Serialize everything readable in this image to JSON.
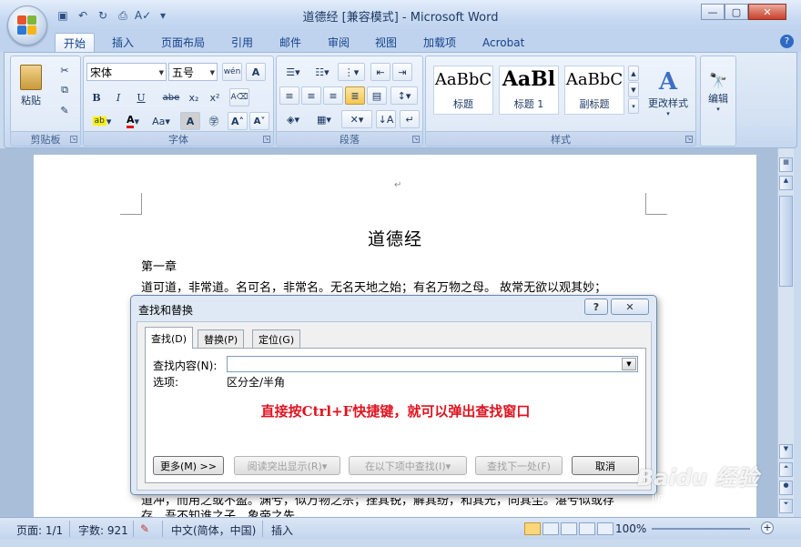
{
  "window": {
    "title": "道德经 [兼容模式] - Microsoft Word",
    "controls": {
      "minimize": "—",
      "maximize": "▢",
      "close": "✕"
    }
  },
  "qat": {
    "items": [
      "save-icon",
      "undo-icon",
      "redo-icon",
      "print-preview-icon",
      "spelling-icon",
      "customize-icon"
    ]
  },
  "tabs": [
    "开始",
    "插入",
    "页面布局",
    "引用",
    "邮件",
    "审阅",
    "视图",
    "加载项",
    "Acrobat"
  ],
  "ribbon": {
    "clipboard": {
      "label": "剪贴板",
      "paste": "粘贴"
    },
    "font": {
      "label": "字体",
      "font_name": "宋体",
      "font_size": "五号",
      "buttons": [
        "B",
        "I",
        "U",
        "abe",
        "x₂",
        "x²",
        "Aa"
      ]
    },
    "paragraph": {
      "label": "段落"
    },
    "styles": {
      "label": "样式",
      "tiles": [
        {
          "sample": "AaBbC",
          "name": "标题"
        },
        {
          "sample": "AaBl",
          "name": "标题 1"
        },
        {
          "sample": "AaBbC",
          "name": "副标题"
        }
      ],
      "change_styles": "更改样式"
    },
    "editing": {
      "label": "编辑"
    }
  },
  "document": {
    "title": "道德经",
    "chapter": "第一章",
    "line1": "道可道，非常道。名可名，非常名。无名天地之始；有名万物之母。 故常无欲以观其妙；",
    "line_partial": "道冲，而用之或不盈。渊兮，似万物之宗；挫其锐，解其纷，和其光，同其尘。湛兮似或存",
    "line_last": "存。吾不知谁之子，象帝之先。"
  },
  "dialog": {
    "title": "查找和替换",
    "help": "?",
    "close": "✕",
    "tabs": [
      "查找(D)",
      "替换(P)",
      "定位(G)"
    ],
    "find_label": "查找内容(N):",
    "find_value": "",
    "options_label": "选项:",
    "options_value": "区分全/半角",
    "annotation": "直接按Ctrl+F快捷键，就可以弹出查找窗口",
    "buttons": {
      "more": "更多(M) >>",
      "reading_highlight": "阅读突出显示(R)▾",
      "find_in": "在以下项中查找(I)▾",
      "find_next": "查找下一处(F)",
      "cancel": "取消"
    }
  },
  "status": {
    "page": "页面: 1/1",
    "words": "字数: 921",
    "language": "中文(简体，中国)",
    "mode": "插入",
    "zoom": "100%"
  },
  "watermark": {
    "text": "Baidu 经验",
    "url": "jingyan.baidu.com"
  }
}
